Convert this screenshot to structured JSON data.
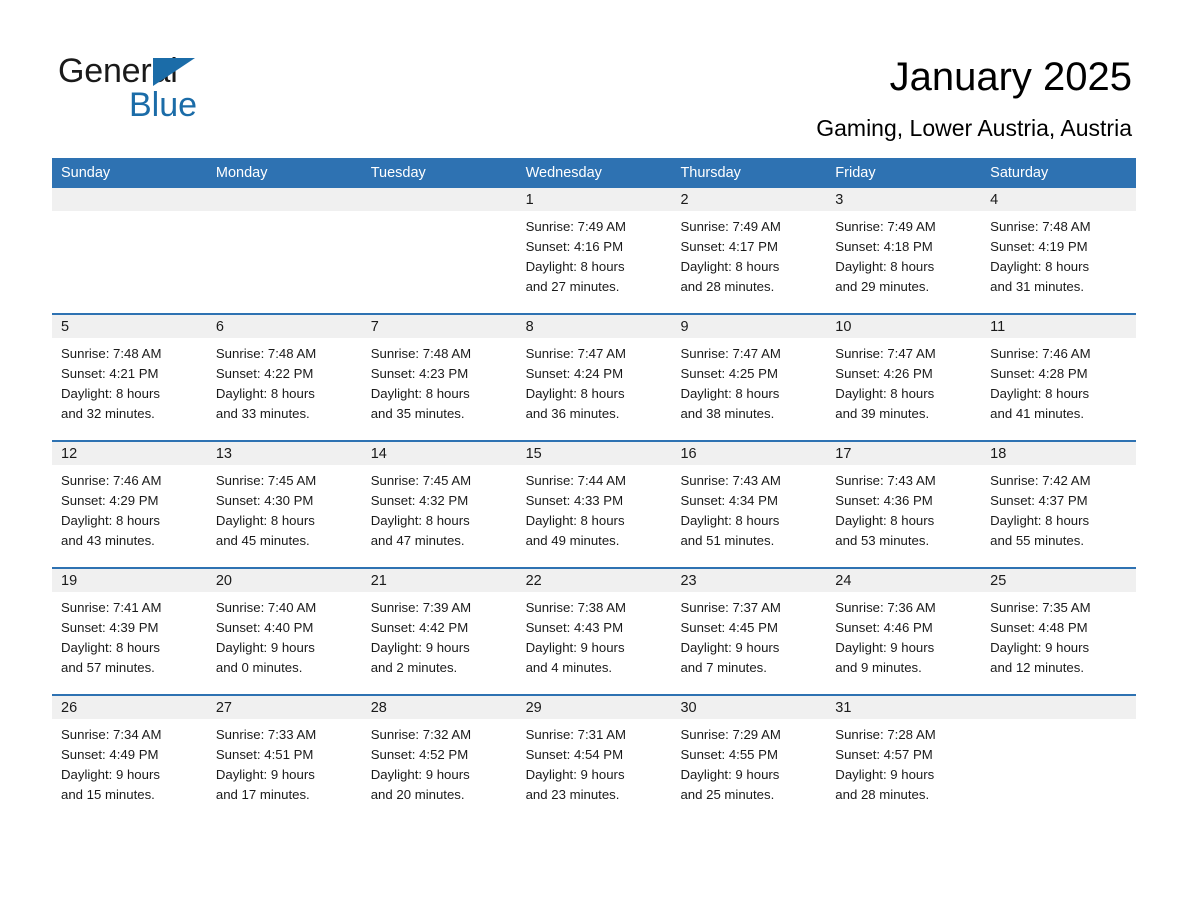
{
  "brand": {
    "name_part1": "General",
    "name_part2": "Blue",
    "triangle_icon": "triangle-icon",
    "accent_color": "#1b6ca8"
  },
  "header": {
    "title": "January 2025",
    "subtitle": "Gaming, Lower Austria, Austria"
  },
  "theme": {
    "header_blue": "#2e72b2",
    "day_band_gray": "#f0f0f0",
    "text_color": "#1a1a1a"
  },
  "calendar": {
    "weekdays": [
      "Sunday",
      "Monday",
      "Tuesday",
      "Wednesday",
      "Thursday",
      "Friday",
      "Saturday"
    ],
    "weeks": [
      [
        {
          "day": "",
          "lines": []
        },
        {
          "day": "",
          "lines": []
        },
        {
          "day": "",
          "lines": []
        },
        {
          "day": "1",
          "lines": [
            "Sunrise: 7:49 AM",
            "Sunset: 4:16 PM",
            "Daylight: 8 hours",
            "and 27 minutes."
          ]
        },
        {
          "day": "2",
          "lines": [
            "Sunrise: 7:49 AM",
            "Sunset: 4:17 PM",
            "Daylight: 8 hours",
            "and 28 minutes."
          ]
        },
        {
          "day": "3",
          "lines": [
            "Sunrise: 7:49 AM",
            "Sunset: 4:18 PM",
            "Daylight: 8 hours",
            "and 29 minutes."
          ]
        },
        {
          "day": "4",
          "lines": [
            "Sunrise: 7:48 AM",
            "Sunset: 4:19 PM",
            "Daylight: 8 hours",
            "and 31 minutes."
          ]
        }
      ],
      [
        {
          "day": "5",
          "lines": [
            "Sunrise: 7:48 AM",
            "Sunset: 4:21 PM",
            "Daylight: 8 hours",
            "and 32 minutes."
          ]
        },
        {
          "day": "6",
          "lines": [
            "Sunrise: 7:48 AM",
            "Sunset: 4:22 PM",
            "Daylight: 8 hours",
            "and 33 minutes."
          ]
        },
        {
          "day": "7",
          "lines": [
            "Sunrise: 7:48 AM",
            "Sunset: 4:23 PM",
            "Daylight: 8 hours",
            "and 35 minutes."
          ]
        },
        {
          "day": "8",
          "lines": [
            "Sunrise: 7:47 AM",
            "Sunset: 4:24 PM",
            "Daylight: 8 hours",
            "and 36 minutes."
          ]
        },
        {
          "day": "9",
          "lines": [
            "Sunrise: 7:47 AM",
            "Sunset: 4:25 PM",
            "Daylight: 8 hours",
            "and 38 minutes."
          ]
        },
        {
          "day": "10",
          "lines": [
            "Sunrise: 7:47 AM",
            "Sunset: 4:26 PM",
            "Daylight: 8 hours",
            "and 39 minutes."
          ]
        },
        {
          "day": "11",
          "lines": [
            "Sunrise: 7:46 AM",
            "Sunset: 4:28 PM",
            "Daylight: 8 hours",
            "and 41 minutes."
          ]
        }
      ],
      [
        {
          "day": "12",
          "lines": [
            "Sunrise: 7:46 AM",
            "Sunset: 4:29 PM",
            "Daylight: 8 hours",
            "and 43 minutes."
          ]
        },
        {
          "day": "13",
          "lines": [
            "Sunrise: 7:45 AM",
            "Sunset: 4:30 PM",
            "Daylight: 8 hours",
            "and 45 minutes."
          ]
        },
        {
          "day": "14",
          "lines": [
            "Sunrise: 7:45 AM",
            "Sunset: 4:32 PM",
            "Daylight: 8 hours",
            "and 47 minutes."
          ]
        },
        {
          "day": "15",
          "lines": [
            "Sunrise: 7:44 AM",
            "Sunset: 4:33 PM",
            "Daylight: 8 hours",
            "and 49 minutes."
          ]
        },
        {
          "day": "16",
          "lines": [
            "Sunrise: 7:43 AM",
            "Sunset: 4:34 PM",
            "Daylight: 8 hours",
            "and 51 minutes."
          ]
        },
        {
          "day": "17",
          "lines": [
            "Sunrise: 7:43 AM",
            "Sunset: 4:36 PM",
            "Daylight: 8 hours",
            "and 53 minutes."
          ]
        },
        {
          "day": "18",
          "lines": [
            "Sunrise: 7:42 AM",
            "Sunset: 4:37 PM",
            "Daylight: 8 hours",
            "and 55 minutes."
          ]
        }
      ],
      [
        {
          "day": "19",
          "lines": [
            "Sunrise: 7:41 AM",
            "Sunset: 4:39 PM",
            "Daylight: 8 hours",
            "and 57 minutes."
          ]
        },
        {
          "day": "20",
          "lines": [
            "Sunrise: 7:40 AM",
            "Sunset: 4:40 PM",
            "Daylight: 9 hours",
            "and 0 minutes."
          ]
        },
        {
          "day": "21",
          "lines": [
            "Sunrise: 7:39 AM",
            "Sunset: 4:42 PM",
            "Daylight: 9 hours",
            "and 2 minutes."
          ]
        },
        {
          "day": "22",
          "lines": [
            "Sunrise: 7:38 AM",
            "Sunset: 4:43 PM",
            "Daylight: 9 hours",
            "and 4 minutes."
          ]
        },
        {
          "day": "23",
          "lines": [
            "Sunrise: 7:37 AM",
            "Sunset: 4:45 PM",
            "Daylight: 9 hours",
            "and 7 minutes."
          ]
        },
        {
          "day": "24",
          "lines": [
            "Sunrise: 7:36 AM",
            "Sunset: 4:46 PM",
            "Daylight: 9 hours",
            "and 9 minutes."
          ]
        },
        {
          "day": "25",
          "lines": [
            "Sunrise: 7:35 AM",
            "Sunset: 4:48 PM",
            "Daylight: 9 hours",
            "and 12 minutes."
          ]
        }
      ],
      [
        {
          "day": "26",
          "lines": [
            "Sunrise: 7:34 AM",
            "Sunset: 4:49 PM",
            "Daylight: 9 hours",
            "and 15 minutes."
          ]
        },
        {
          "day": "27",
          "lines": [
            "Sunrise: 7:33 AM",
            "Sunset: 4:51 PM",
            "Daylight: 9 hours",
            "and 17 minutes."
          ]
        },
        {
          "day": "28",
          "lines": [
            "Sunrise: 7:32 AM",
            "Sunset: 4:52 PM",
            "Daylight: 9 hours",
            "and 20 minutes."
          ]
        },
        {
          "day": "29",
          "lines": [
            "Sunrise: 7:31 AM",
            "Sunset: 4:54 PM",
            "Daylight: 9 hours",
            "and 23 minutes."
          ]
        },
        {
          "day": "30",
          "lines": [
            "Sunrise: 7:29 AM",
            "Sunset: 4:55 PM",
            "Daylight: 9 hours",
            "and 25 minutes."
          ]
        },
        {
          "day": "31",
          "lines": [
            "Sunrise: 7:28 AM",
            "Sunset: 4:57 PM",
            "Daylight: 9 hours",
            "and 28 minutes."
          ]
        },
        {
          "day": "",
          "lines": []
        }
      ]
    ]
  }
}
